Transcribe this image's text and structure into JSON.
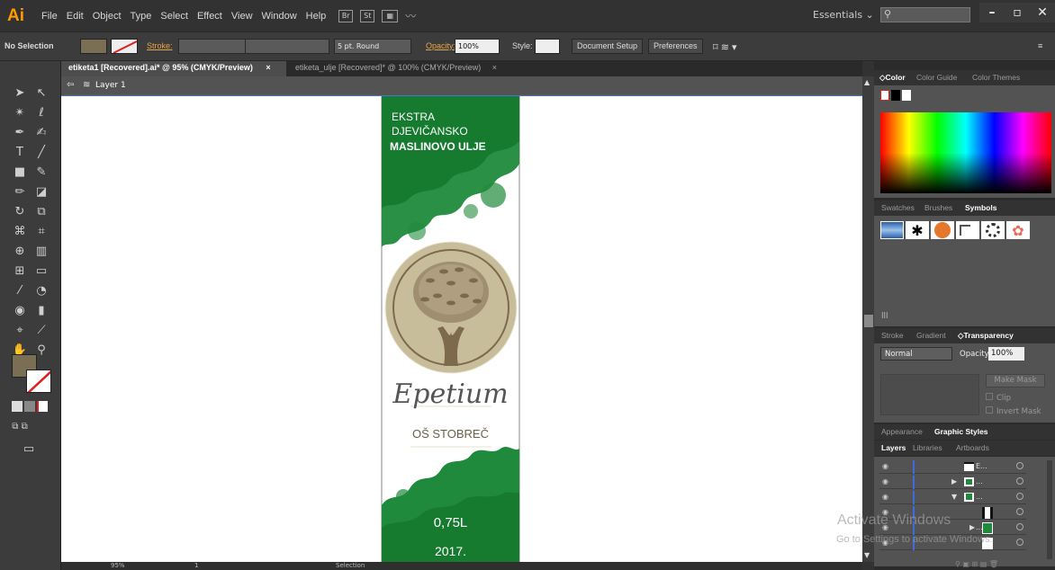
{
  "app": {
    "logo": "Ai",
    "workspace": "Essentials ⌄"
  },
  "menu": [
    "File",
    "Edit",
    "Object",
    "Type",
    "Select",
    "Effect",
    "View",
    "Window",
    "Help"
  ],
  "menubar_buttons": [
    "Br",
    "St"
  ],
  "control": {
    "selection_label": "No Selection",
    "stroke_label": "Stroke:",
    "brush_label": "5 pt. Round",
    "opacity_label": "Opacity:",
    "opacity_value": "100%",
    "style_label": "Style:",
    "doc_setup": "Document Setup",
    "preferences": "Preferences"
  },
  "tabs": [
    {
      "label": "etiketa1 [Recovered].ai* @ 95% (CMYK/Preview)",
      "close": "×"
    },
    {
      "label": "etiketa_ulje [Recovered]* @ 100% (CMYK/Preview)",
      "close": "×"
    }
  ],
  "layer_bar": {
    "label": "Layer 1"
  },
  "label_art": {
    "line1": "EKSTRA",
    "line2": "DJEVIČANSKO",
    "line3": "MASLINOVO ULJE",
    "brand": "Epetium",
    "school": "OŠ STOBREČ",
    "volume": "0,75L",
    "year": "2017.",
    "green": "#1f8a3c",
    "tan": "#c8bd9b",
    "tree_brown": "#7d6a4c"
  },
  "status": {
    "zoom": "95%",
    "page": "1",
    "tool": "Selection"
  },
  "panels": {
    "color_tabs": [
      "◇Color",
      "Color Guide",
      "Color Themes"
    ],
    "symbol_tabs": [
      "Swatches",
      "Brushes",
      "Symbols"
    ],
    "transparency_tabs": [
      "Stroke",
      "Gradient",
      "◇Transparency"
    ],
    "blend_mode": "Normal",
    "opacity_label": "Opacity:",
    "opacity_value": "100%",
    "make_mask": "Make Mask",
    "clip": "Clip",
    "invert_mask": "Invert Mask",
    "appearance_tabs": [
      "Appearance",
      "Graphic Styles"
    ],
    "layers_tabs": [
      "Layers",
      "Libraries",
      "Artboards"
    ],
    "layer_names": [
      "E...",
      "...",
      "...",
      "",
      "..."
    ]
  },
  "watermark": {
    "line1": "Activate Windows",
    "line2": "Go to Settings to activate Windows."
  }
}
